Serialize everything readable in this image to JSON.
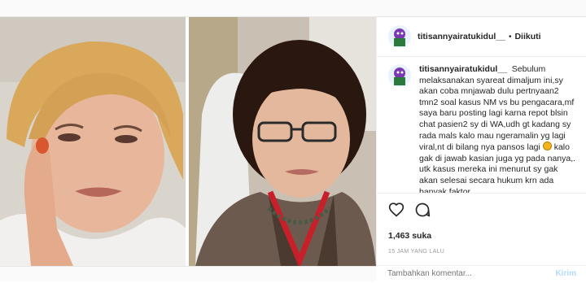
{
  "post": {
    "username": "titisannyairatukidul__",
    "separator": "•",
    "follow_state": "Diikuti",
    "caption_username": "titisannyairatukidul__",
    "caption_part1": "Sebulum melaksanakan syareat dimaljum ini,sy akan coba mnjawab dulu pertnyaan2 tmn2 soal kasus NM vs bu pengacara,mf saya baru posting lagi karna repot blsin chat pasien2 sy di WA,udh gt kadang sy rada mals kalo mau ngeramalin yg lagi viral,nt di bilang nya pansos lagi",
    "caption_part2": " kalo gak di jawab kasian juga yg pada nanya,. utk kasus mereka ini menurut sy gak akan",
    "caption_part3": "selesai secara hukum krn ada banyak faktor",
    "likes": "1,463 suka",
    "timestamp": "15 JAM YANG LALU",
    "comment_placeholder": "Tambahkan komentar...",
    "send_label": "Kirim"
  },
  "icons": {
    "like": "heart-icon",
    "comment": "comment-icon",
    "emoji": "grinning-face-emoji"
  }
}
